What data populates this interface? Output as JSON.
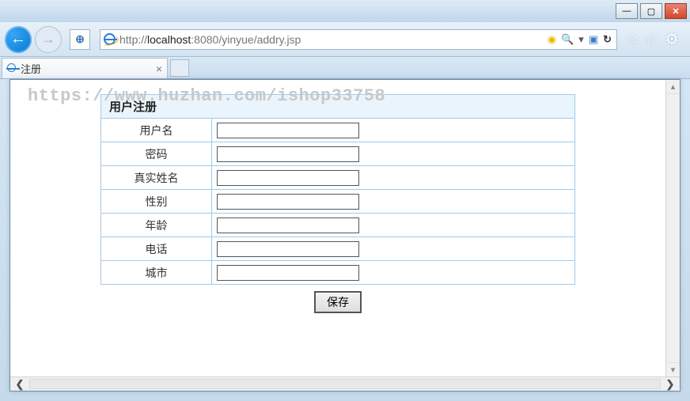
{
  "window": {
    "minimize": "—",
    "maximize": "▢",
    "close": "✕"
  },
  "nav": {
    "back_icon": "←",
    "forward_icon": "→",
    "compat_icon": "⊕",
    "url_prefix": "http://",
    "url_host": "localhost",
    "url_path": ":8080/yinyue/addry.jsp",
    "search_dropdown": "▾",
    "refresh_icon": "↻"
  },
  "tab": {
    "title": "注册",
    "close": "×"
  },
  "chrome": {
    "home": "⌂",
    "favorites": "☆",
    "settings": "⚙"
  },
  "watermark": "https://www.huzhan.com/ishop33758",
  "form": {
    "title": "用户注册",
    "fields": [
      {
        "label": "用户名",
        "name": "username"
      },
      {
        "label": "密码",
        "name": "password"
      },
      {
        "label": "真实姓名",
        "name": "realname"
      },
      {
        "label": "性别",
        "name": "gender"
      },
      {
        "label": "年龄",
        "name": "age"
      },
      {
        "label": "电话",
        "name": "phone"
      },
      {
        "label": "城市",
        "name": "city"
      }
    ],
    "submit": "保存"
  },
  "scroll": {
    "up": "▴",
    "down": "▾",
    "left": "❮",
    "right": "❯"
  }
}
